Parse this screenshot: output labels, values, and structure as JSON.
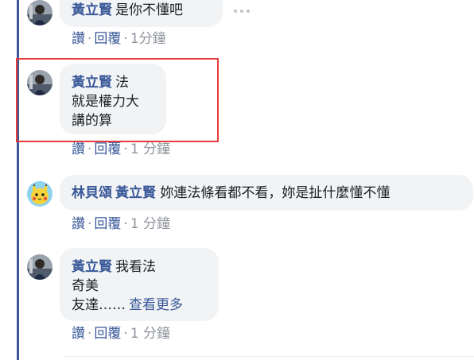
{
  "comments": [
    {
      "author": "黃立賢",
      "lines": [
        "是你不懂吧"
      ],
      "actions": {
        "like": "讚",
        "reply": "回覆",
        "time": "1分鐘"
      }
    },
    {
      "author": "黃立賢",
      "lines": [
        "法",
        "就是權力大",
        "講的算"
      ],
      "actions": {
        "like": "讚",
        "reply": "回覆",
        "time": "1 分鐘"
      }
    },
    {
      "author": "林貝頌",
      "mention": "黃立賢",
      "lines": [
        "妳連法條看都不看，妳是扯什麼懂不懂"
      ],
      "actions": {
        "like": "讚",
        "reply": "回覆",
        "time": "1 分鐘"
      }
    },
    {
      "author": "黃立賢",
      "lines": [
        "我看法",
        "奇美",
        "友達……"
      ],
      "see_more": "查看更多",
      "actions": {
        "like": "讚",
        "reply": "回覆",
        "time": "1 分鐘"
      }
    }
  ],
  "separator": "·",
  "icons": {
    "more": "more-horizontal-icon",
    "avatar_1": "user-photo-avatar",
    "avatar_2": "cartoon-pikachu-avatar"
  },
  "colors": {
    "name_link": "#385898",
    "bubble_bg": "#f2f3f5",
    "thread_line": "#3b5998",
    "highlight": "#e53b3b",
    "meta": "#90949c"
  }
}
